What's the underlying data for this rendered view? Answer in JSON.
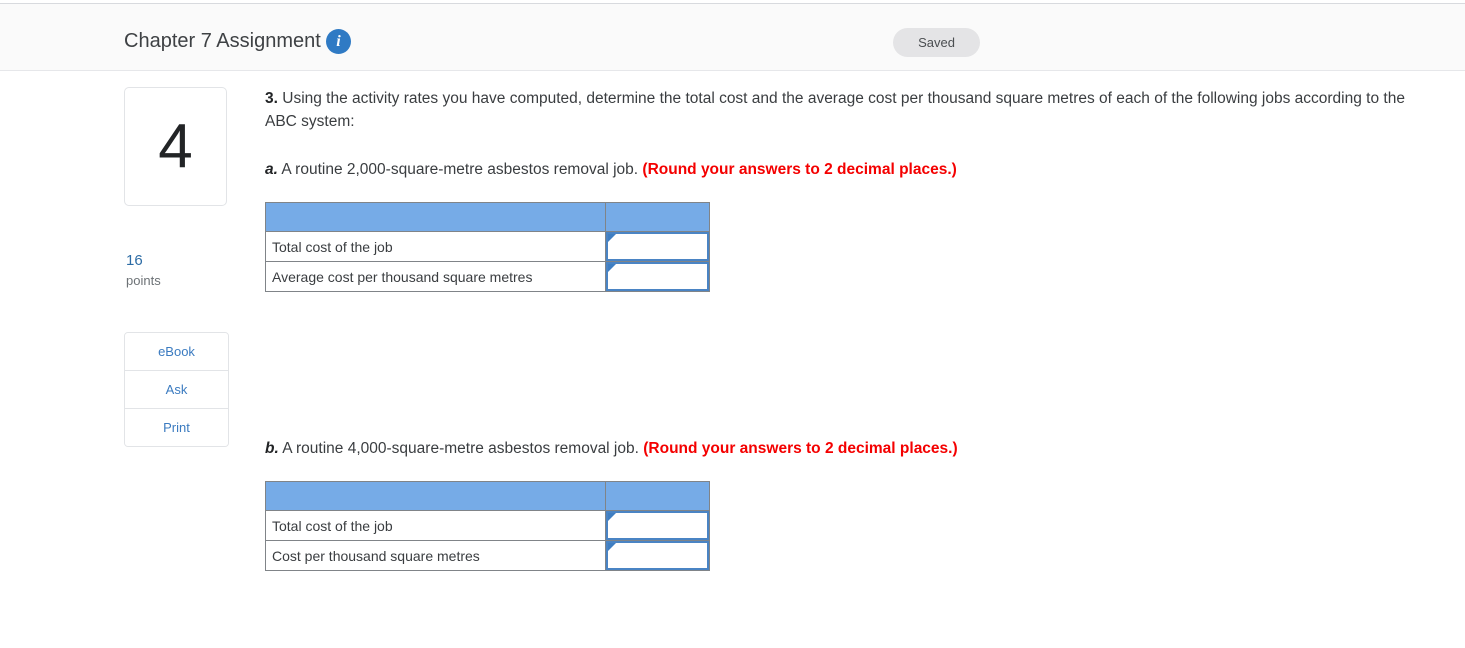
{
  "header": {
    "title": "Chapter 7 Assignment",
    "info_icon": "info-icon",
    "status_badge": "Saved"
  },
  "left_rail": {
    "question_number": "4",
    "points_value": "16",
    "points_label": "points",
    "buttons": [
      {
        "label": "eBook",
        "name": "ebook-button"
      },
      {
        "label": "Ask",
        "name": "ask-button"
      },
      {
        "label": "Print",
        "name": "print-button"
      }
    ]
  },
  "question": {
    "number": "3.",
    "stem": "Using the activity rates you have computed, determine the total cost and the average cost per thousand square metres of each of the following jobs according to the ABC system:",
    "parts": [
      {
        "letter": "a.",
        "text": "A routine 2,000-square-metre asbestos removal job.",
        "instruction": "(Round your answers to 2 decimal places.)",
        "table": {
          "header": [
            "",
            ""
          ],
          "rows": [
            {
              "label": "Total cost of the job",
              "value": ""
            },
            {
              "label": "Average cost per thousand square metres",
              "value": ""
            }
          ]
        }
      },
      {
        "letter": "b.",
        "text": "A routine 4,000-square-metre asbestos removal job.",
        "instruction": "(Round your answers to 2 decimal places.)",
        "table": {
          "header": [
            "",
            ""
          ],
          "rows": [
            {
              "label": "Total cost of the job",
              "value": ""
            },
            {
              "label": "Cost per thousand square metres",
              "value": ""
            }
          ]
        }
      }
    ]
  },
  "colors": {
    "table_header_blue": "#76abe7",
    "input_border_blue": "#4a84c4",
    "instruction_red": "#f40000",
    "link_blue": "#3b7bc0",
    "points_blue": "#2d6ca5"
  }
}
